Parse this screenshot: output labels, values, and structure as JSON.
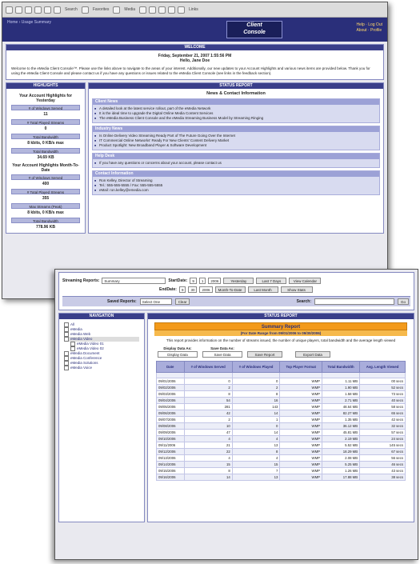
{
  "screen1": {
    "toolbar": {
      "back": "Back",
      "forward": "",
      "search": "Search",
      "favorites": "Favorites",
      "media": "Media",
      "history": "",
      "print": "",
      "links": "Links"
    },
    "brand": {
      "crumbs": [
        "Home",
        "Usage Summary"
      ],
      "logo_line1": "Client",
      "logo_line2": "Console",
      "topnav": [
        "Help",
        "Log Out",
        "About",
        "Profile"
      ]
    },
    "welcome": {
      "header": "WELCOME",
      "date": "Friday, September 21, 2007 1:55:56 PM",
      "name": "Hello, Jane Doe",
      "body": "Welcome to the eMedia Client Console™. Please use the links above to navigate to the areas of your interest. Additionally, our new updates to your Account Highlights and various news items are provided below. Thank you for using the eMedia Client Console and please contact us if you have any questions or issues related to the eMedia Client Console (see links in the feedback section)."
    },
    "highlights": {
      "header": "HIGHLIGHTS",
      "yesterday_title": "Your Account Highlights for Yesterday",
      "yesterday": [
        {
          "label": "# of Windows Served",
          "value": "11"
        },
        {
          "label": "# Total Played Streams",
          "value": "0"
        },
        {
          "label": "Total Bandwidth",
          "value": "8 kbits, 0 KB/s max"
        },
        {
          "label": "Total Bandwidth",
          "value": "34.69 KB"
        }
      ],
      "month_title": "Your Account Highlights Month-To-Date",
      "month": [
        {
          "label": "# of Windows Served",
          "value": "400"
        },
        {
          "label": "# Total Played Streams",
          "value": "355"
        },
        {
          "label": "Max Streams (Peak)",
          "value": "8 kbits, 0 KB/s max"
        },
        {
          "label": "Total Bandwidth",
          "value": "778.96 KB"
        }
      ]
    },
    "news": {
      "header": "STATUS REPORT",
      "title": "News & Contact Information",
      "sections": [
        {
          "title": "Client News",
          "items": [
            "A detailed look at the latest service rollout, part of the eMedia Network",
            "It is the ideal time to upgrade the Digital Online Media Content Services",
            "The eMedia Business Client Console and the eMedia Streaming Business Model by Streaming Ringing"
          ]
        },
        {
          "title": "Industry News",
          "items": [
            "Is Online Delivery Video Streaming Ready Part of The Future Going Over the Internet",
            "IT Commercial Online Networks' Ready For New Clients' Content Delivery Market",
            "Product Spotlight: New Broadband Player & Software Development"
          ]
        },
        {
          "title": "Help Desk",
          "items": [
            "If you have any questions or concerns about your account, please contact us"
          ]
        },
        {
          "title": "Contact Information",
          "items": [
            "Ron Kelley, Director of Streaming",
            "Tel.: 555-555-5555 / Fax: 555-555-5555",
            "eMail: ron.kelley@emedia.com"
          ]
        }
      ]
    }
  },
  "screen2": {
    "streaming_reports_label": "Streaming Reports:",
    "streaming_reports_value": "Summary",
    "start_date_label": "StartDate:",
    "end_date_label": "EndDate:",
    "start_parts": [
      "9",
      "1",
      "2006"
    ],
    "end_parts": [
      "9",
      "30",
      "2006"
    ],
    "range_buttons": [
      "Yesterday",
      "Last 7 Days",
      "View Calendar",
      "Month-To-Date",
      "Last Month",
      "Show Stats"
    ],
    "saved_reports_label": "Saved Reports:",
    "saved_reports_value": "Select One",
    "saved_button": "Clear",
    "search_label": "Search:",
    "search_button": "Go",
    "tree_header": "NAVIGATION",
    "tree": [
      {
        "label": "All",
        "level": 0
      },
      {
        "label": "eMedia",
        "level": 0
      },
      {
        "label": "eMedia Web",
        "level": 0
      },
      {
        "label": "eMedia Video",
        "level": 0,
        "selected": true
      },
      {
        "label": "eMedia Video 01",
        "level": 1
      },
      {
        "label": "eMedia Video 02",
        "level": 1
      },
      {
        "label": "eMedia Document",
        "level": 0
      },
      {
        "label": "eMedia Conference",
        "level": 0
      },
      {
        "label": "eMedia Solutions",
        "level": 0
      },
      {
        "label": "eMedia Voice",
        "level": 0
      }
    ],
    "report_header": "STATUS REPORT",
    "summary_title": "Summary Report",
    "summary_sub": "(For Date Range from 09/01/2006 to 09/30/2006)",
    "summary_desc": "This report provides information on the number of streams issued, the number of unique players, total bandwidth and the average length viewed",
    "display_data_label": "Display Data As:",
    "display_data_value": "Display Data",
    "save_data_label": "Save Data As:",
    "save_data_value": "Save Data",
    "save_report_button": "Save Report",
    "export_button": "Export Data",
    "table": {
      "headers": [
        "Date",
        "# of Windows Served",
        "# of Windows Played",
        "Top Player Format",
        "Total Bandwidth",
        "Avg. Length Viewed"
      ],
      "total": [
        "",
        "",
        "",
        "",
        "",
        ""
      ],
      "rows": [
        [
          "09/01/2006",
          "0",
          "0",
          "WMP",
          "1.11 MB",
          "00 secs"
        ],
        [
          "09/02/2006",
          "2",
          "2",
          "WMP",
          "1.90 MB",
          "52 secs"
        ],
        [
          "09/03/2006",
          "8",
          "8",
          "WMP",
          "1.58 MB",
          "73 secs"
        ],
        [
          "09/04/2006",
          "54",
          "16",
          "WMP",
          "2.71 MB",
          "40 secs"
        ],
        [
          "09/05/2006",
          "281",
          "143",
          "WMP",
          "48.64 MB",
          "58 secs"
        ],
        [
          "09/06/2006",
          "42",
          "14",
          "WMP",
          "82.27 MB",
          "65 secs"
        ],
        [
          "09/07/2006",
          "2",
          "1",
          "WMP",
          "1.35 MB",
          "42 secs"
        ],
        [
          "09/08/2006",
          "10",
          "0",
          "WMP",
          "36.12 MB",
          "32 secs"
        ],
        [
          "09/09/2006",
          "47",
          "14",
          "WMP",
          "45.81 MB",
          "57 secs"
        ],
        [
          "09/10/2006",
          "4",
          "4",
          "WMP",
          "2.19 MB",
          "24 secs"
        ],
        [
          "09/11/2006",
          "21",
          "13",
          "WMP",
          "5.52 MB",
          "145 secs"
        ],
        [
          "09/12/2006",
          "22",
          "8",
          "WMP",
          "18.29 MB",
          "67 secs"
        ],
        [
          "09/13/2006",
          "4",
          "4",
          "WMP",
          "2.08 MB",
          "56 secs"
        ],
        [
          "09/14/2006",
          "15",
          "15",
          "WMP",
          "5.25 MB",
          "46 secs"
        ],
        [
          "09/15/2006",
          "8",
          "7",
          "WMP",
          "1.26 MB",
          "43 secs"
        ],
        [
          "09/16/2006",
          "14",
          "13",
          "WMP",
          "17.88 MB",
          "38 secs"
        ]
      ]
    }
  }
}
